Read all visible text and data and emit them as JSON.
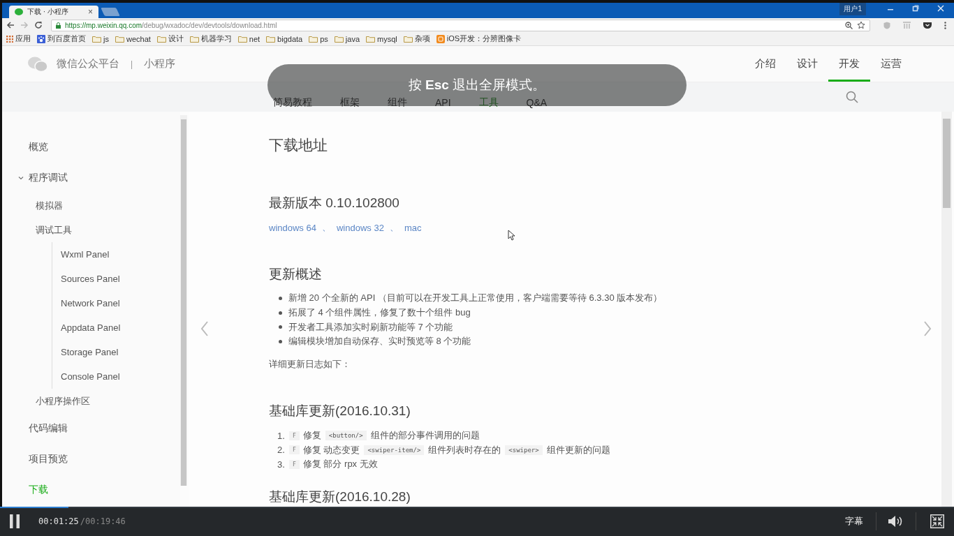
{
  "browser": {
    "tab": {
      "title": "下载 · 小程序",
      "close": "×"
    },
    "user": "用户1",
    "address": {
      "url_origin": "https://mp.weixin.qq.com",
      "url_path": "/debug/wxadoc/dev/devtools/download.html"
    },
    "bookmarks": [
      {
        "kind": "apps",
        "label": "应用"
      },
      {
        "kind": "page",
        "label": "到百度首页"
      },
      {
        "kind": "folder",
        "label": "js"
      },
      {
        "kind": "folder",
        "label": "wechat"
      },
      {
        "kind": "folder",
        "label": "设计"
      },
      {
        "kind": "folder",
        "label": "机器学习"
      },
      {
        "kind": "folder",
        "label": "net"
      },
      {
        "kind": "folder",
        "label": "bigdata"
      },
      {
        "kind": "folder",
        "label": "ps"
      },
      {
        "kind": "folder",
        "label": "java"
      },
      {
        "kind": "folder",
        "label": "mysql"
      },
      {
        "kind": "folder",
        "label": "杂项"
      },
      {
        "kind": "site",
        "label": "iOS开发：分辨图像卡"
      }
    ]
  },
  "site_header": {
    "brand": "微信公众平台",
    "separator": "|",
    "product": "小程序",
    "nav": [
      {
        "label": "介绍",
        "selected": false
      },
      {
        "label": "设计",
        "selected": false
      },
      {
        "label": "开发",
        "selected": true
      },
      {
        "label": "运营",
        "selected": false
      }
    ]
  },
  "subnav": [
    {
      "label": "简易教程",
      "selected": false
    },
    {
      "label": "框架",
      "selected": false
    },
    {
      "label": "组件",
      "selected": false
    },
    {
      "label": "API",
      "selected": false
    },
    {
      "label": "工具",
      "selected": true
    },
    {
      "label": "Q&A",
      "selected": false
    }
  ],
  "sidebar": {
    "items": [
      {
        "label": "概览",
        "selected": false
      },
      {
        "label": "程序调试",
        "selected": false,
        "expanded": true,
        "children": [
          {
            "label": "模拟器",
            "selected": false
          },
          {
            "label": "调试工具",
            "selected": false,
            "children": [
              {
                "label": "Wxml Panel",
                "selected": false
              },
              {
                "label": "Sources Panel",
                "selected": false
              },
              {
                "label": "Network Panel",
                "selected": false
              },
              {
                "label": "Appdata Panel",
                "selected": false
              },
              {
                "label": "Storage Panel",
                "selected": false
              },
              {
                "label": "Console Panel",
                "selected": false
              }
            ]
          },
          {
            "label": "小程序操作区",
            "selected": false
          }
        ]
      },
      {
        "label": "代码编辑",
        "selected": false
      },
      {
        "label": "项目预览",
        "selected": false
      },
      {
        "label": "下载",
        "selected": true
      }
    ]
  },
  "content": {
    "title": "下载地址",
    "version_heading": "最新版本 0.10.102800",
    "downloads": [
      {
        "label": "windows 64",
        "separator": "、"
      },
      {
        "label": "windows 32",
        "separator": "、"
      },
      {
        "label": "mac"
      }
    ],
    "overview_heading": "更新概述",
    "overview": [
      "新增 20 个全新的 API （目前可以在开发工具上正常使用，客户端需要等待 6.3.30 版本发布）",
      "拓展了 4 个组件属性，修复了数十个组件 bug",
      "开发者工具添加实时刷新功能等 7 个功能",
      "编辑模块增加自动保存、实时预览等 8 个功能"
    ],
    "log_intro": "详细更新日志如下：",
    "releases": [
      {
        "heading": "基础库更新(2016.10.31)",
        "items": [
          {
            "number": "1.",
            "tag": "F",
            "parts": [
              {
                "kind": "text",
                "text": "修复"
              },
              {
                "kind": "code",
                "text": "<button/>"
              },
              {
                "kind": "text",
                "text": "组件的部分事件调用的问题"
              }
            ]
          },
          {
            "number": "2.",
            "tag": "F",
            "parts": [
              {
                "kind": "text",
                "text": "修复 动态变更"
              },
              {
                "kind": "code",
                "text": "<swiper-item/>"
              },
              {
                "kind": "text",
                "text": "组件列表时存在的"
              },
              {
                "kind": "code",
                "text": "<swiper>"
              },
              {
                "kind": "text",
                "text": "组件更新的问题"
              }
            ]
          },
          {
            "number": "3.",
            "tag": "F",
            "parts": [
              {
                "kind": "text",
                "text": "修复 部分 rpx 无效"
              }
            ]
          }
        ]
      },
      {
        "heading": "基础库更新(2016.10.28)"
      }
    ]
  },
  "overlay": {
    "message": "按 **Esc** 退出全屏模式。"
  },
  "player": {
    "playing": true,
    "level": 0.072,
    "current_time": "00:01:25",
    "duration": "/00:19:46",
    "subtitles": "字幕"
  }
}
